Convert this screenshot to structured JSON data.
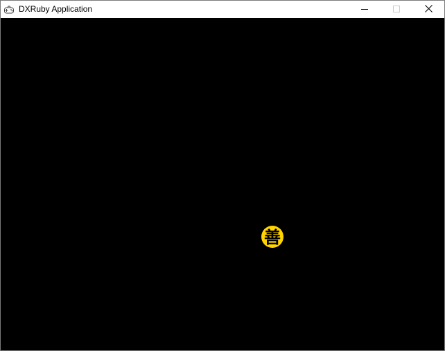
{
  "window": {
    "title": "DXRuby Application",
    "app_icon": "gamepad-icon",
    "controls": {
      "minimize_icon": "minimize-icon",
      "maximize_icon": "maximize-icon",
      "close_icon": "close-icon"
    }
  },
  "canvas": {
    "background": "#000000",
    "sprite": {
      "glyph": "善",
      "fill_color": "#ffd400",
      "glyph_color": "#000000"
    }
  }
}
